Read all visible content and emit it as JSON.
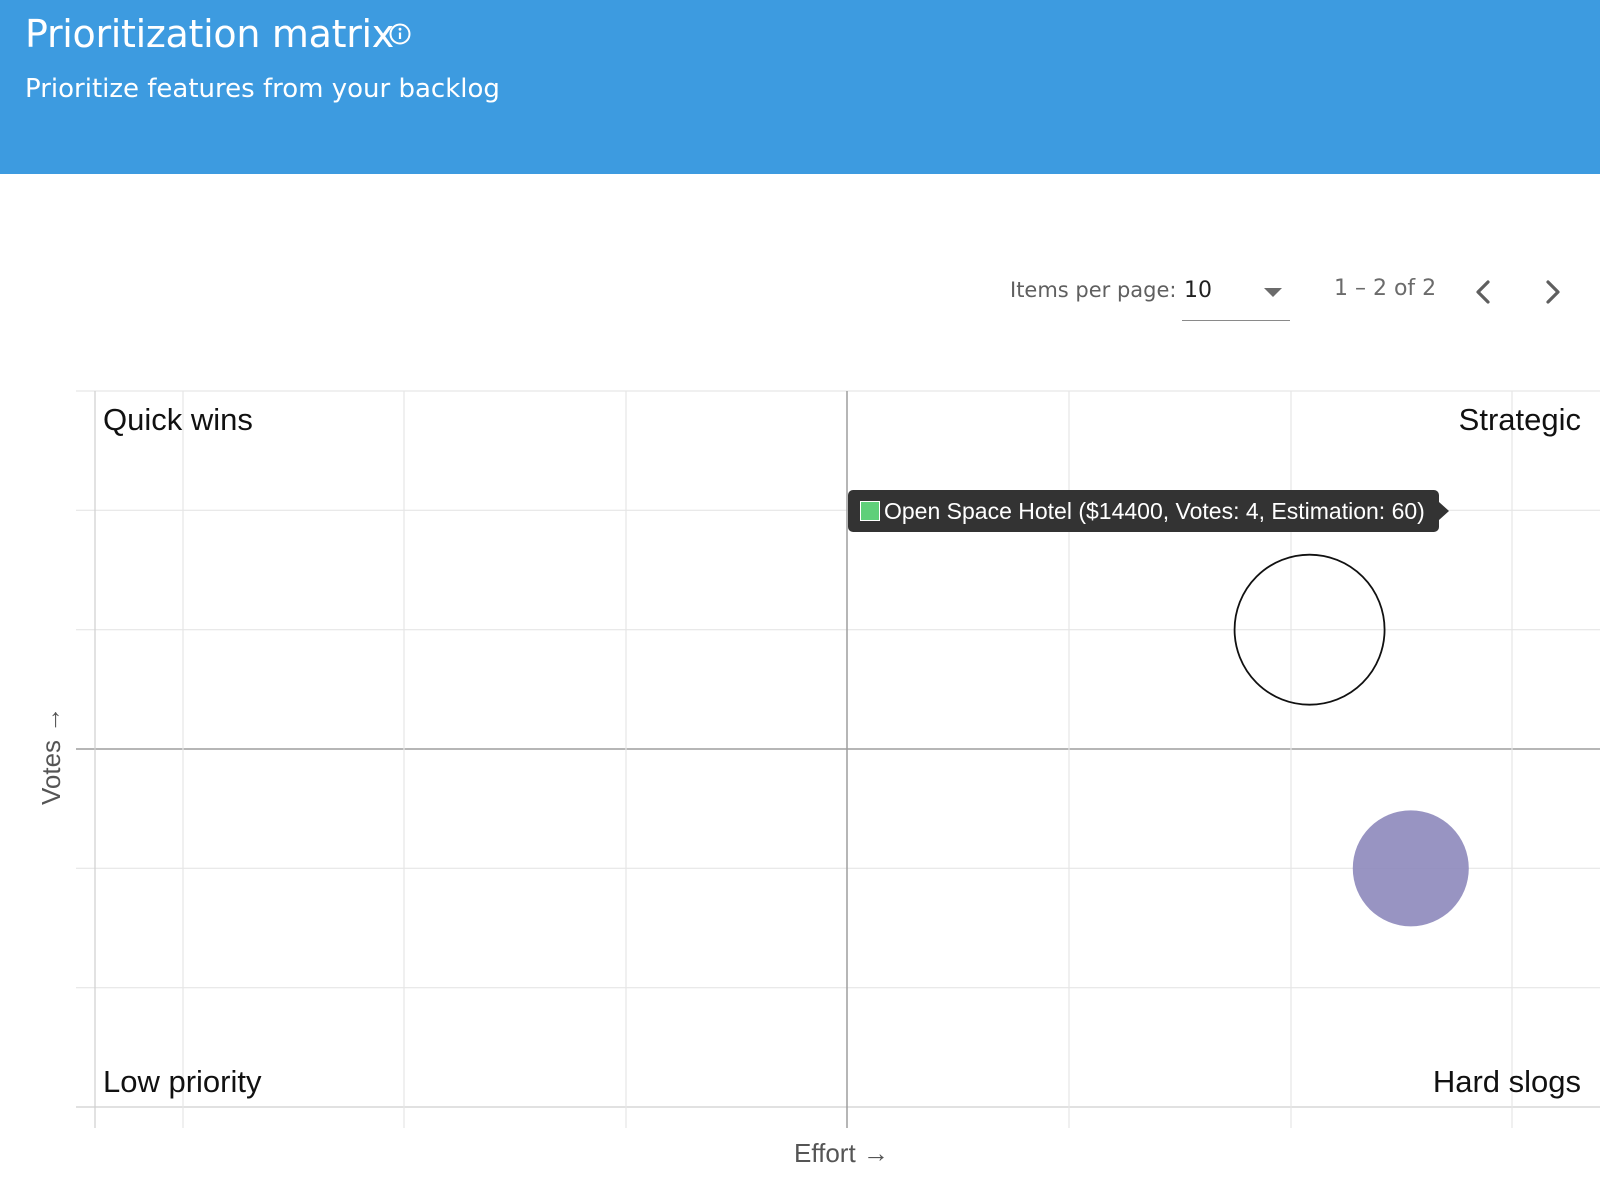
{
  "header": {
    "title": "Prioritization matrix",
    "subtitle": "Prioritize features from your backlog",
    "info_icon": "info-icon",
    "background_color": "#3d9be0"
  },
  "paginator": {
    "items_per_page_label": "Items per page:",
    "items_per_page_value": "10",
    "range_label": "1 – 2 of 2",
    "prev_icon": "chevron-left-icon",
    "next_icon": "chevron-right-icon"
  },
  "chart_data": {
    "type": "scatter",
    "xlabel": "Effort →",
    "ylabel": "Votes →",
    "quadrants": {
      "top_left": "Quick wins",
      "top_right": "Strategic",
      "bottom_left": "Low priority",
      "bottom_right": "Hard slogs"
    },
    "points": [
      {
        "label": "Open Space Hotel",
        "price": 14400,
        "votes": 4,
        "estimation": 60,
        "color": "#5fcf7a",
        "highlighted": true
      },
      {
        "label": "",
        "votes": 2,
        "estimation": 65,
        "color": "#8d88bb",
        "highlighted": false
      }
    ],
    "tooltip": "Open Space Hotel ($14400, Votes: 4, Estimation: 60)",
    "tooltip_swatch_color": "#5fcf7a",
    "grid": true
  }
}
